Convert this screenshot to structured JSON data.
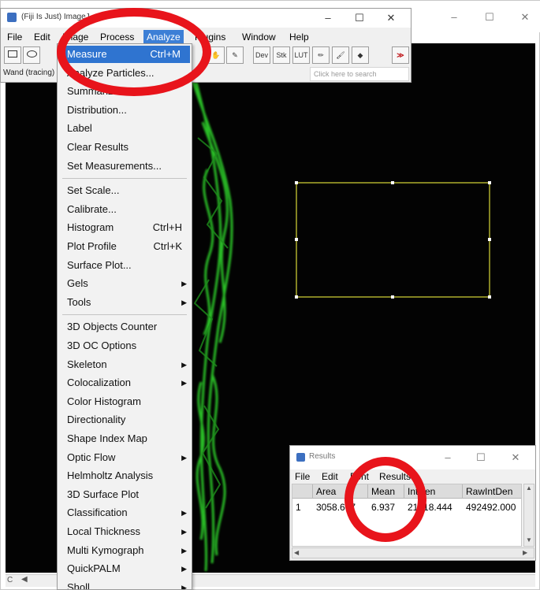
{
  "image_window": {
    "min_glyph": "–",
    "max_glyph": "☐",
    "close_glyph": "✕",
    "scroll_left_label": "C"
  },
  "imagej": {
    "title": "(Fiji Is Just) ImageJ",
    "min_glyph": "–",
    "max_glyph": "☐",
    "close_glyph": "✕",
    "menubar": [
      "File",
      "Edit",
      "Image",
      "Process",
      "Analyze",
      "Plugins",
      "Window",
      "Help"
    ],
    "active_menu": "Analyze",
    "tools": {
      "dev": "Dev",
      "stk": "Stk",
      "lut": "LUT",
      "more": "≫"
    },
    "status_text": "Wand (tracing)",
    "search_placeholder": "Click here to search"
  },
  "analyze_menu": {
    "items": [
      {
        "label": "Measure",
        "shortcut": "Ctrl+M",
        "selected": true
      },
      {
        "label": "Analyze Particles..."
      },
      {
        "label": "Summarize"
      },
      {
        "label": "Distribution..."
      },
      {
        "label": "Label"
      },
      {
        "label": "Clear Results"
      },
      {
        "label": "Set Measurements..."
      },
      {
        "label": "Set Scale..."
      },
      {
        "label": "Calibrate..."
      },
      {
        "label": "Histogram",
        "shortcut": "Ctrl+H"
      },
      {
        "label": "Plot Profile",
        "shortcut": "Ctrl+K"
      },
      {
        "label": "Surface Plot..."
      },
      {
        "label": "Gels",
        "submenu": true
      },
      {
        "label": "Tools",
        "submenu": true
      },
      {
        "label": "3D Objects Counter"
      },
      {
        "label": "3D OC Options"
      },
      {
        "label": "Skeleton",
        "submenu": true
      },
      {
        "label": "Colocalization",
        "submenu": true
      },
      {
        "label": "Color Histogram"
      },
      {
        "label": "Directionality"
      },
      {
        "label": "Shape Index Map"
      },
      {
        "label": "Optic Flow",
        "submenu": true
      },
      {
        "label": "Helmholtz Analysis"
      },
      {
        "label": "3D Surface Plot"
      },
      {
        "label": "Classification",
        "submenu": true
      },
      {
        "label": "Local Thickness",
        "submenu": true
      },
      {
        "label": "Multi Kymograph",
        "submenu": true
      },
      {
        "label": "QuickPALM",
        "submenu": true
      },
      {
        "label": "Sholl",
        "submenu": true
      }
    ],
    "submenu_arrow": "▶"
  },
  "results": {
    "title": "Results",
    "min_glyph": "–",
    "max_glyph": "☐",
    "close_glyph": "✕",
    "menu": [
      "File",
      "Edit",
      "Font",
      "Results"
    ],
    "columns": [
      "",
      "Area",
      "Mean",
      "IntDen",
      "RawIntDen"
    ],
    "rows": [
      [
        "1",
        "3058.667",
        "6.937",
        "21218.444",
        "492492.000"
      ]
    ],
    "scroll_up": "▲",
    "scroll_down": "▼",
    "scroll_left": "◀",
    "scroll_right": "▶"
  },
  "colors": {
    "annotation": "#e8141b",
    "selection_blue": "#2f74d0",
    "roi_yellow": "#c8c832",
    "fluorescence_green": "#2fd12a"
  }
}
